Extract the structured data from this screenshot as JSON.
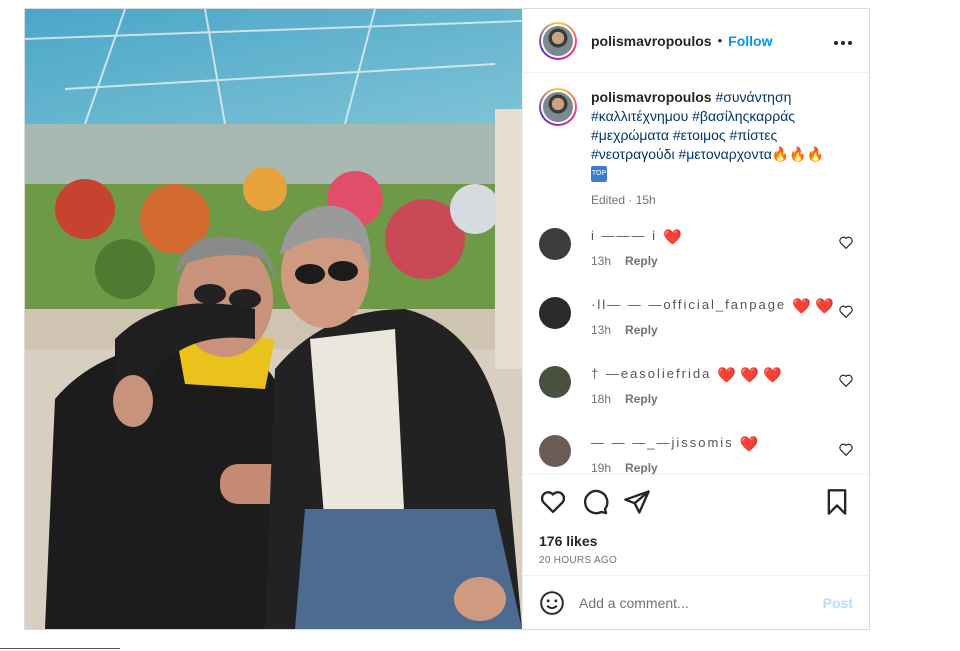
{
  "post": {
    "username": "polismavropoulos",
    "separator": "•",
    "follow_label": "Follow",
    "more_label": "•••",
    "caption": {
      "username": "polismavropoulos",
      "line1_tag": "#συνάντηση",
      "line2": "#καλλιτέχνημου #βασίληςκαρράς",
      "line3": "#μεχρώματα #ετοιμος #πίστες",
      "line4": "#νεοτραγούδι #μετοναρχοντα🔥🔥🔥",
      "badge": "TOP"
    },
    "edited_label": "Edited · 15h"
  },
  "comments": [
    {
      "name": "i  ———  i",
      "hearts": "❤️",
      "time": "13h",
      "reply": "Reply",
      "avatar_color": "#3c3c3c"
    },
    {
      "name": "·ll— — —official_fanpage",
      "hearts": "❤️ ❤️",
      "time": "13h",
      "reply": "Reply",
      "avatar_color": "#2a2a2a"
    },
    {
      "name": "† —easoliefrida",
      "hearts": "❤️ ❤️ ❤️",
      "time": "18h",
      "reply": "Reply",
      "avatar_color": "#4a5040"
    },
    {
      "name": "— — —_—jissomis",
      "hearts": "❤️",
      "time": "19h",
      "reply": "Reply",
      "avatar_color": "#6b5b55"
    }
  ],
  "actions": {
    "likes": "176 likes",
    "time_ago": "20 HOURS AGO"
  },
  "add_comment": {
    "placeholder": "Add a comment...",
    "post_label": "Post"
  },
  "colors": {
    "link": "#0095f6",
    "hashtag": "#00376b",
    "post_disabled": "#b2dffc"
  }
}
